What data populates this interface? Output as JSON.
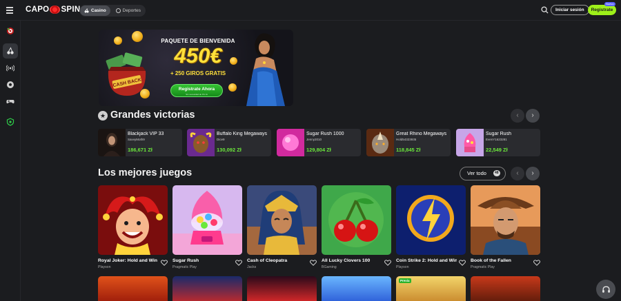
{
  "header": {
    "logo_left": "CAPO",
    "logo_right": "SPIN",
    "tabs": [
      {
        "label": "Casino",
        "active": true
      },
      {
        "label": "Deportes",
        "active": false
      }
    ],
    "login_label": "Iniciar sesión",
    "register_label": "Registrate",
    "register_badge": "Nuevo"
  },
  "sidebar": {
    "items": [
      {
        "icon": "promo-target-icon",
        "active": false
      },
      {
        "icon": "cherries-icon",
        "active": true
      },
      {
        "icon": "live-broadcast-icon",
        "active": false
      },
      {
        "icon": "soccer-ball-icon",
        "active": false
      },
      {
        "icon": "gamepad-icon",
        "active": false
      },
      {
        "icon": "shield-icon",
        "active": false
      }
    ]
  },
  "banner": {
    "title": "PAQUETE DE BIENVENIDA",
    "amount": "450€",
    "subtitle": "+ 250 GIROS GRATIS",
    "cta_label": "Registrate Ahora",
    "cta_note": "Sin necesidad de Pin IA",
    "cashback_text": "CASH BACK"
  },
  "big_wins": {
    "title": "Grandes victorias",
    "items": [
      {
        "game": "Blackjack VIP 33",
        "user": "SavvyMoth9",
        "amount": "186,671 Zł"
      },
      {
        "game": "Buffalo King Megaways",
        "user": "Dice9",
        "amount": "130,092 Zł"
      },
      {
        "game": "Sugar Rush 1000",
        "user": "Jenny2010",
        "amount": "129,804 Zł"
      },
      {
        "game": "Great Rhino Megaways",
        "user": "Hold54323935",
        "amount": "118,845 Zł"
      },
      {
        "game": "Sugar Rush",
        "user": "EvenY1623281",
        "amount": "22,549 Zł"
      }
    ]
  },
  "best_games": {
    "title": "Los mejores juegos",
    "see_all_label": "Ver todo",
    "see_all_count": "48",
    "items": [
      {
        "name": "Royal Joker: Hold and Win",
        "provider": "Playson"
      },
      {
        "name": "Sugar Rush",
        "provider": "Pragmatic Play"
      },
      {
        "name": "Cash of Cleopatra",
        "provider": "Jacks"
      },
      {
        "name": "All Lucky Clovers 100",
        "provider": "BGaming"
      },
      {
        "name": "Coin Strike 2: Hold and Win",
        "provider": "Playson"
      },
      {
        "name": "Book of the Fallen",
        "provider": "Pragmatic Play"
      }
    ],
    "next_row_badge": "Previa"
  },
  "colors": {
    "accent_green": "#9ef01a",
    "win_green": "#6be83b",
    "gold": "#ffe13b",
    "background": "#1b1c1f"
  }
}
